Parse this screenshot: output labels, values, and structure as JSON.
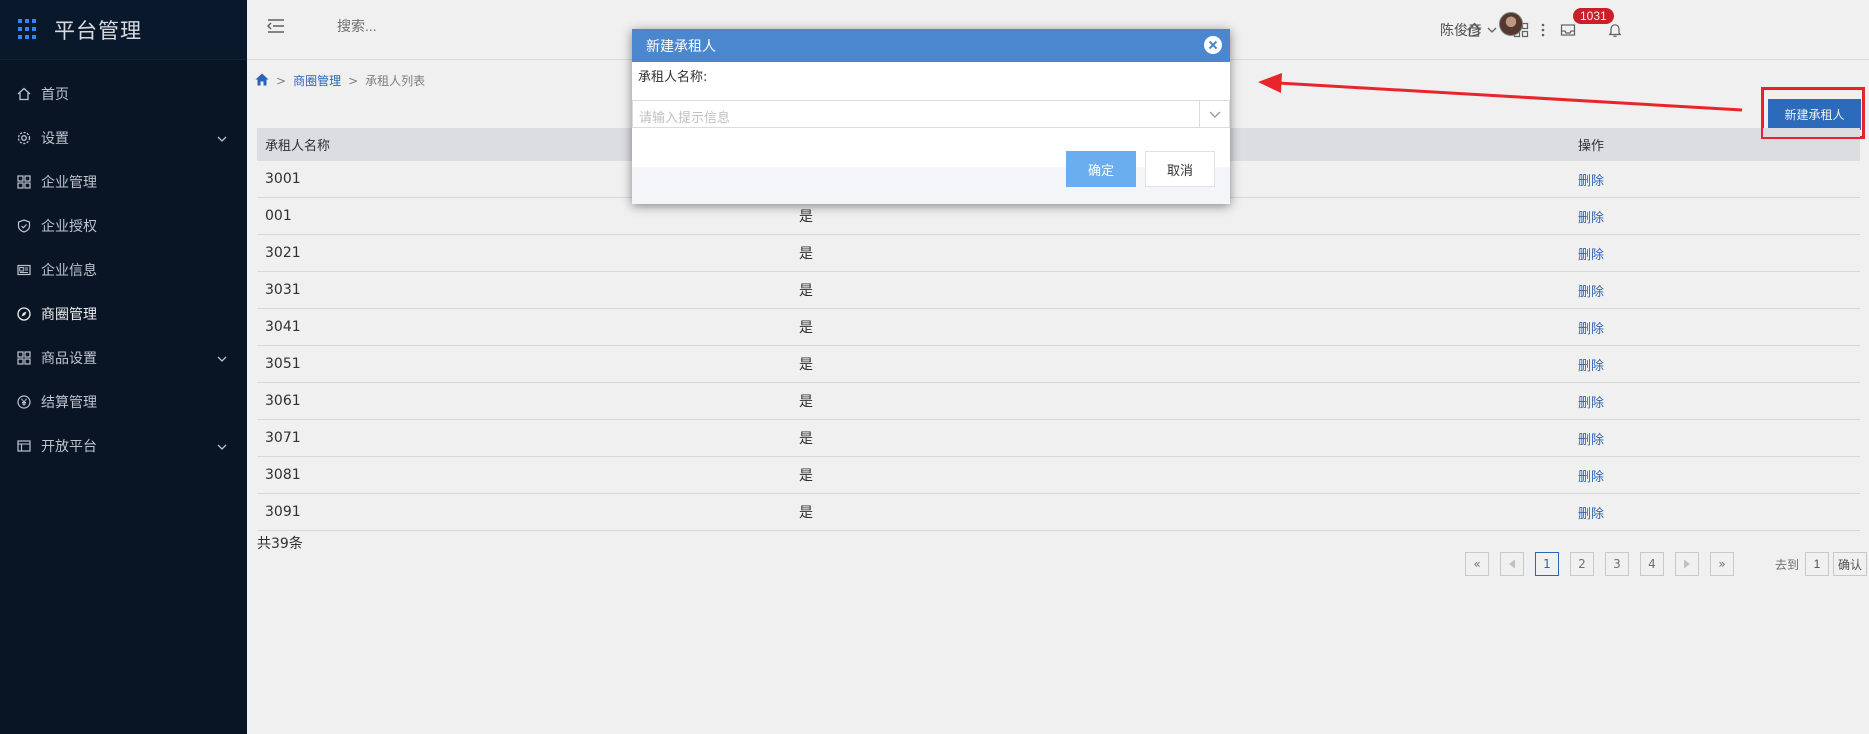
{
  "brand": {
    "title": "平台管理"
  },
  "sidebar": {
    "items": [
      {
        "label": "首页",
        "icon": "home-icon",
        "has_children": false
      },
      {
        "label": "设置",
        "icon": "gear-icon",
        "has_children": true
      },
      {
        "label": "企业管理",
        "icon": "grid-icon",
        "has_children": false
      },
      {
        "label": "企业授权",
        "icon": "shield-icon",
        "has_children": false
      },
      {
        "label": "企业信息",
        "icon": "id-card-icon",
        "has_children": false
      },
      {
        "label": "商圈管理",
        "icon": "compass-icon",
        "has_children": false
      },
      {
        "label": "商品设置",
        "icon": "apps-icon",
        "has_children": true
      },
      {
        "label": "结算管理",
        "icon": "yen-icon",
        "has_children": false
      },
      {
        "label": "开放平台",
        "icon": "table-icon",
        "has_children": true
      }
    ]
  },
  "header": {
    "search_placeholder": "搜索...",
    "notification_count": "1031",
    "user_name": "陈俊彦"
  },
  "breadcrumb": {
    "items": [
      "商圈管理",
      "承租人列表"
    ]
  },
  "toolbar": {
    "new_button_label": "新建承租人"
  },
  "table": {
    "headers": [
      "承租人名称",
      "",
      "操作"
    ],
    "rows": [
      {
        "name": "3001",
        "flag": "",
        "action": "删除"
      },
      {
        "name": "001",
        "flag": "是",
        "action": "删除"
      },
      {
        "name": "3021",
        "flag": "是",
        "action": "删除"
      },
      {
        "name": "3031",
        "flag": "是",
        "action": "删除"
      },
      {
        "name": "3041",
        "flag": "是",
        "action": "删除"
      },
      {
        "name": "3051",
        "flag": "是",
        "action": "删除"
      },
      {
        "name": "3061",
        "flag": "是",
        "action": "删除"
      },
      {
        "name": "3071",
        "flag": "是",
        "action": "删除"
      },
      {
        "name": "3081",
        "flag": "是",
        "action": "删除"
      },
      {
        "name": "3091",
        "flag": "是",
        "action": "删除"
      }
    ],
    "total_text": "共39条"
  },
  "pagination": {
    "first": "«",
    "prev": "‹",
    "pages": [
      "1",
      "2",
      "3",
      "4"
    ],
    "current_page": "1",
    "next": "›",
    "last": "»",
    "goto_label": "去到",
    "goto_value": "1",
    "goto_button": "确认"
  },
  "modal": {
    "title": "新建承租人",
    "field_label": "承租人名称:",
    "select_placeholder": "请输入提示信息",
    "ok_label": "确定",
    "cancel_label": "取消"
  },
  "colors": {
    "sidebar_bg": "#0a1627",
    "accent": "#2f71c8",
    "modal_header": "#4a87cf",
    "ok_button": "#6aaef0",
    "annotation_red": "#e8252b",
    "badge": "#d9202a"
  }
}
